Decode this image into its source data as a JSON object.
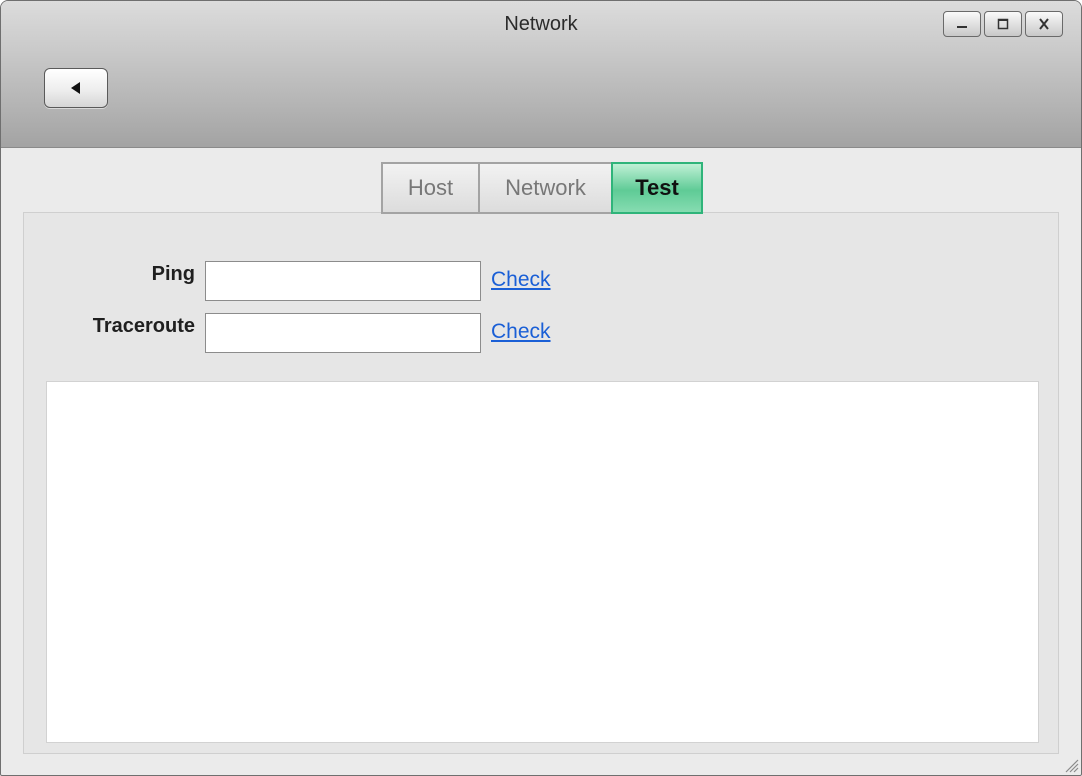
{
  "window": {
    "title": "Network",
    "controls": [
      "minimize",
      "maximize",
      "close"
    ]
  },
  "toolbar": {
    "back_icon": "back-arrow-icon"
  },
  "tabs": [
    {
      "label": "Host",
      "active": false
    },
    {
      "label": "Network",
      "active": false
    },
    {
      "label": "Test",
      "active": true
    }
  ],
  "test_form": {
    "ping": {
      "label": "Ping",
      "value": "",
      "action": "Check"
    },
    "traceroute": {
      "label": "Traceroute",
      "value": "",
      "action": "Check"
    }
  },
  "output": {
    "text": ""
  },
  "colors": {
    "active_tab": "#5fcb96",
    "active_tab_border": "#2fb47a",
    "link": "#1a5fd6",
    "panel_bg": "#e6e6e6"
  }
}
